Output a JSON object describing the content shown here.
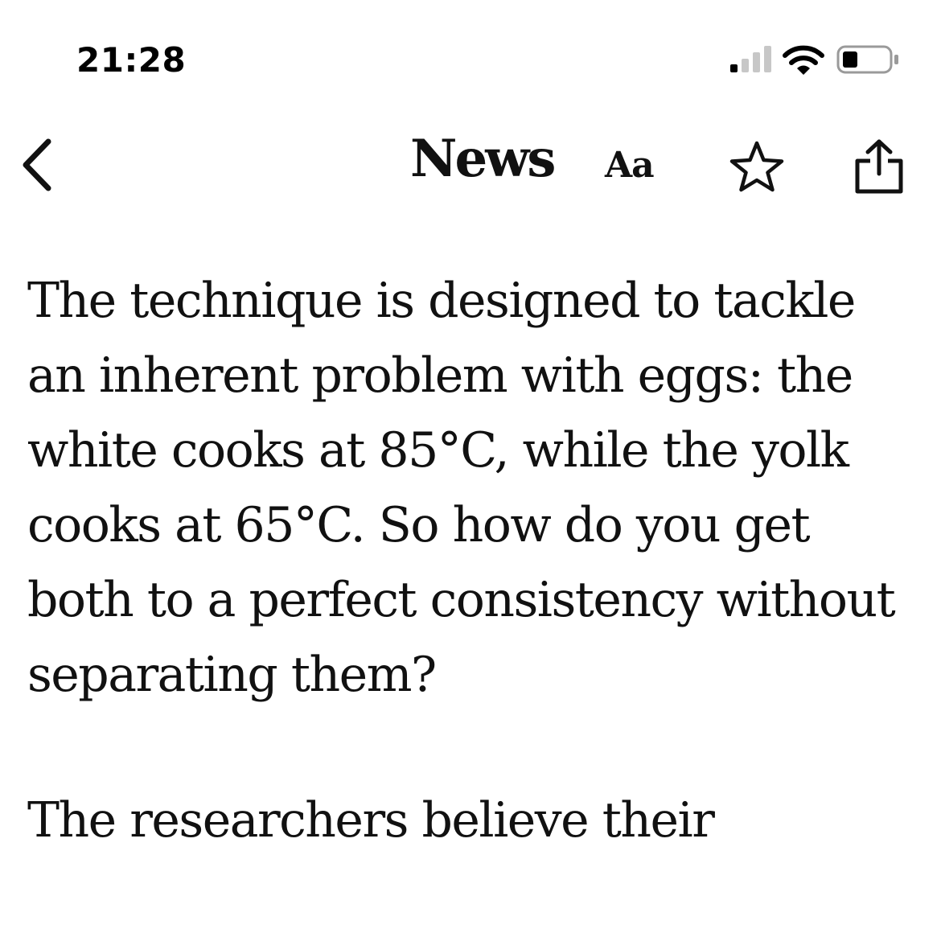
{
  "status_bar": {
    "time": "21:28",
    "icons": [
      "cellular-signal-icon",
      "wifi-icon",
      "battery-icon"
    ]
  },
  "nav": {
    "back_icon": "chevron-left-icon",
    "title": "News",
    "text_size_label": "Aa",
    "favorite_icon": "star-icon",
    "share_icon": "share-icon"
  },
  "article": {
    "paragraphs": [
      "The technique is designed to tackle an inherent problem with eggs: the white cooks at 85°C, while the yolk cooks at 65°C. So how do you get both to a perfect consistency without separating them?",
      "The researchers believe their"
    ]
  },
  "colors": {
    "text": "#111111",
    "background": "#ffffff",
    "signal_inactive": "#c7c7c7"
  }
}
